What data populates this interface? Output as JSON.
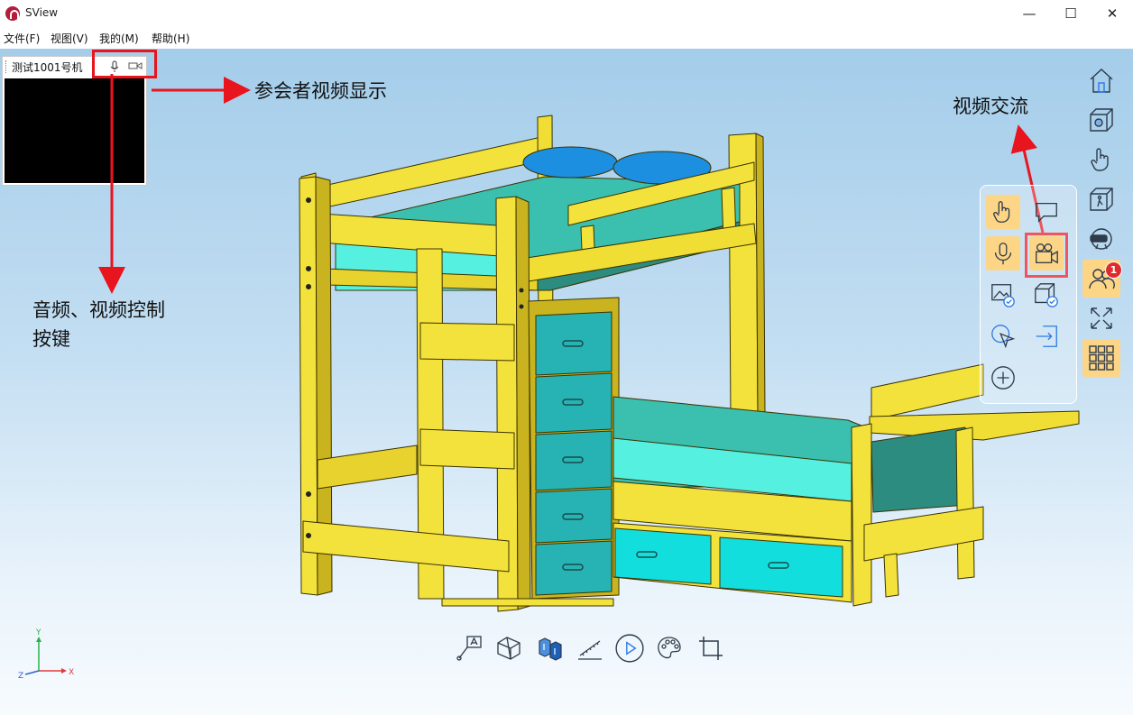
{
  "app": {
    "title": "SView"
  },
  "window_controls": {
    "minimize": "—",
    "maximize": "☐",
    "close": "✕"
  },
  "menu": [
    {
      "label": "文件(F)"
    },
    {
      "label": "视图(V)"
    },
    {
      "label": "我的(M)"
    },
    {
      "label": "帮助(H)"
    }
  ],
  "video_panel": {
    "participant_name": "测试1001号机"
  },
  "annotations": {
    "participant_video": "参会者视频显示",
    "av_controls_line1": "音频、视频控制",
    "av_controls_line2": "按键",
    "video_chat": "视频交流"
  },
  "side_toolbar": {
    "items": [
      {
        "icon": "home-icon"
      },
      {
        "icon": "settings-cube-icon"
      },
      {
        "icon": "hand-pan-icon"
      },
      {
        "icon": "walk-mode-icon"
      },
      {
        "icon": "vr-headset-icon"
      },
      {
        "icon": "participants-icon",
        "badge": "1"
      },
      {
        "icon": "fullscreen-icon"
      },
      {
        "icon": "grid-menu-icon"
      }
    ]
  },
  "collab_panel": {
    "items": [
      {
        "icon": "hand-raise-icon"
      },
      {
        "icon": "chat-icon"
      },
      {
        "icon": "microphone-icon"
      },
      {
        "icon": "video-camera-icon"
      },
      {
        "icon": "image-confirm-icon"
      },
      {
        "icon": "model-confirm-icon"
      },
      {
        "icon": "pointer-icon"
      },
      {
        "icon": "exit-icon"
      },
      {
        "icon": "add-icon"
      }
    ]
  },
  "axis": {
    "x": "X",
    "y": "Y",
    "z": "Z"
  },
  "bottom_toolbar": {
    "items": [
      {
        "icon": "annotation-icon"
      },
      {
        "icon": "section-view-icon"
      },
      {
        "icon": "explode-icon"
      },
      {
        "icon": "measure-icon"
      },
      {
        "icon": "play-icon"
      },
      {
        "icon": "palette-icon"
      },
      {
        "icon": "crop-icon"
      }
    ]
  },
  "colors": {
    "accent_red": "#e8141e",
    "wood_yellow": "#f4e23c",
    "fabric_teal": "#3bbfae",
    "pillow_blue": "#1d8fe0"
  }
}
